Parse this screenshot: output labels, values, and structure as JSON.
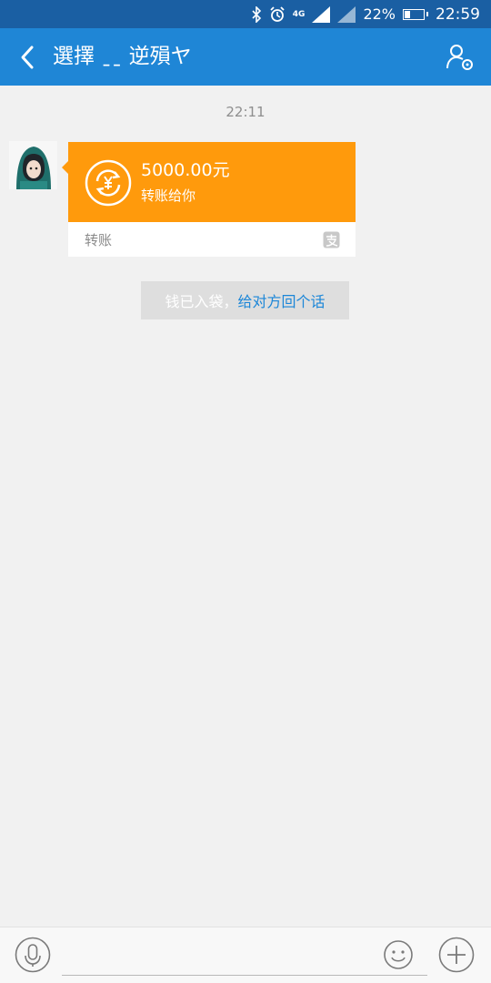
{
  "status_bar": {
    "network": "4G",
    "battery": "22%",
    "time": "22:59"
  },
  "header": {
    "title": "選擇 ˍˍ 逆殞ヤ",
    "back_icon": "chevron-left-icon",
    "profile_icon": "user-settings-icon"
  },
  "chat": {
    "timestamp": "22:11",
    "transfer": {
      "amount": "5000.00元",
      "description": "转账给你",
      "label": "转账",
      "icon": "currency-exchange-icon",
      "brand_icon": "alipay-icon"
    },
    "notice": {
      "prefix": "钱已入袋，",
      "link": "给对方回个话"
    }
  },
  "input_bar": {
    "value": "",
    "voice_icon": "microphone-icon",
    "emoji_icon": "smile-icon",
    "more_icon": "plus-icon"
  },
  "colors": {
    "title_bar": "#1f86d6",
    "status_bar": "#1a5fa3",
    "transfer_orange": "#ff9a0c",
    "link_blue": "#1b86d8",
    "background": "#f1f1f1"
  }
}
